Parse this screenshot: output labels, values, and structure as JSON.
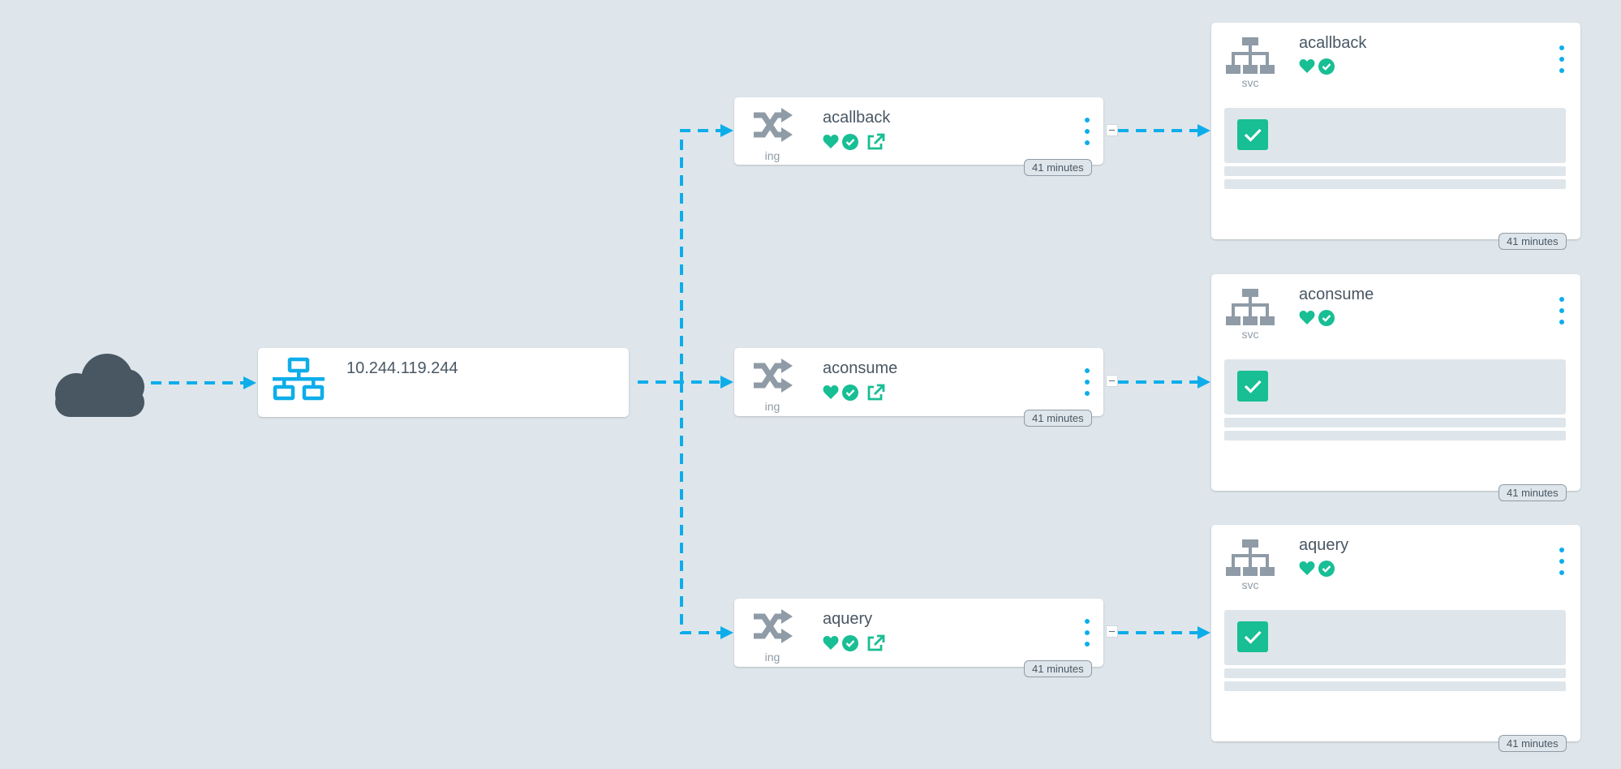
{
  "colors": {
    "background": "#dee6eb",
    "edge": "#0dadea",
    "healthy": "#18be94",
    "icon_gray": "#8f9ba6",
    "icon_blue": "#0dadea",
    "cloud": "#495763"
  },
  "internet": {
    "icon": "cloud-icon"
  },
  "loadbalancer": {
    "title": "10.244.119.244",
    "icon": "network-icon"
  },
  "ingresses": [
    {
      "name": "acallback",
      "kind": "ing",
      "age": "41 minutes",
      "icon": "shuffle-icon",
      "collapse": "–"
    },
    {
      "name": "aconsume",
      "kind": "ing",
      "age": "41 minutes",
      "icon": "shuffle-icon",
      "collapse": "–"
    },
    {
      "name": "aquery",
      "kind": "ing",
      "age": "41 minutes",
      "icon": "shuffle-icon",
      "collapse": "–"
    }
  ],
  "services": [
    {
      "name": "acallback",
      "kind": "svc",
      "age": "41 minutes",
      "icon": "sitemap-icon"
    },
    {
      "name": "aconsume",
      "kind": "svc",
      "age": "41 minutes",
      "icon": "sitemap-icon"
    },
    {
      "name": "aquery",
      "kind": "svc",
      "age": "41 minutes",
      "icon": "sitemap-icon"
    }
  ]
}
